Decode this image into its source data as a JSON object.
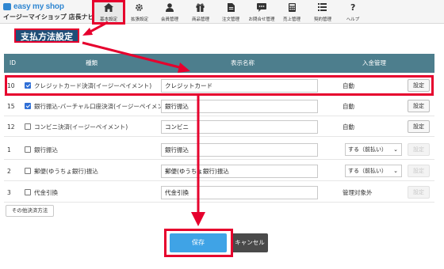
{
  "logo": {
    "brand": "easy my shop",
    "subtitle": "イージーマイショップ 店長ナビ"
  },
  "nav": [
    {
      "label": "基本設定",
      "icon": "home-icon"
    },
    {
      "label": "拡張設定",
      "icon": "gear-icon"
    },
    {
      "label": "会員管理",
      "icon": "user-icon"
    },
    {
      "label": "商品管理",
      "icon": "gift-icon"
    },
    {
      "label": "注文管理",
      "icon": "document-icon"
    },
    {
      "label": "お問合せ管理",
      "icon": "chat-icon"
    },
    {
      "label": "売上管理",
      "icon": "calculator-icon"
    },
    {
      "label": "契約管理",
      "icon": "list-icon"
    },
    {
      "label": "ヘルプ",
      "icon": "question-icon"
    }
  ],
  "page_title": "支払方法設定",
  "table": {
    "headers": {
      "id": "ID",
      "type": "種類",
      "display": "表示名称",
      "deposit": "入金管理"
    },
    "rows": [
      {
        "id": "10",
        "checked": true,
        "type": "クレジットカード決済(イージーペイメント)",
        "display": "クレジットカード",
        "deposit": "自動",
        "setting": "設定",
        "setting_enabled": true
      },
      {
        "id": "15",
        "checked": true,
        "type": "銀行振込-バーチャル口座決済(イージーペイメント)",
        "display": "銀行振込",
        "deposit": "自動",
        "setting": "設定",
        "setting_enabled": true
      },
      {
        "id": "12",
        "checked": false,
        "type": "コンビニ決済(イージーペイメント)",
        "display": "コンビニ",
        "deposit": "自動",
        "setting": "設定",
        "setting_enabled": true
      },
      {
        "id": "1",
        "checked": false,
        "type": "銀行振込",
        "display": "銀行振込",
        "deposit": "する（前払い）",
        "deposit_select": true,
        "setting": "設定",
        "setting_enabled": false
      },
      {
        "id": "2",
        "checked": false,
        "type": "郵便(ゆうちょ銀行)振込",
        "display": "郵便(ゆうちょ銀行)振込",
        "deposit": "する（前払い）",
        "deposit_select": true,
        "setting": "設定",
        "setting_enabled": false
      },
      {
        "id": "3",
        "checked": false,
        "type": "代金引換",
        "display": "代金引換",
        "deposit": "管理対象外",
        "setting": "設定",
        "setting_enabled": false
      }
    ]
  },
  "other_button": "その他決済方法",
  "save_button": "保存",
  "cancel_button": "キャンセル",
  "colors": {
    "highlight": "#e6002d",
    "header_bar": "#4d7e8d",
    "title_bg": "#1f4f78",
    "save": "#3fa3e6",
    "cancel": "#4a4a4a"
  }
}
